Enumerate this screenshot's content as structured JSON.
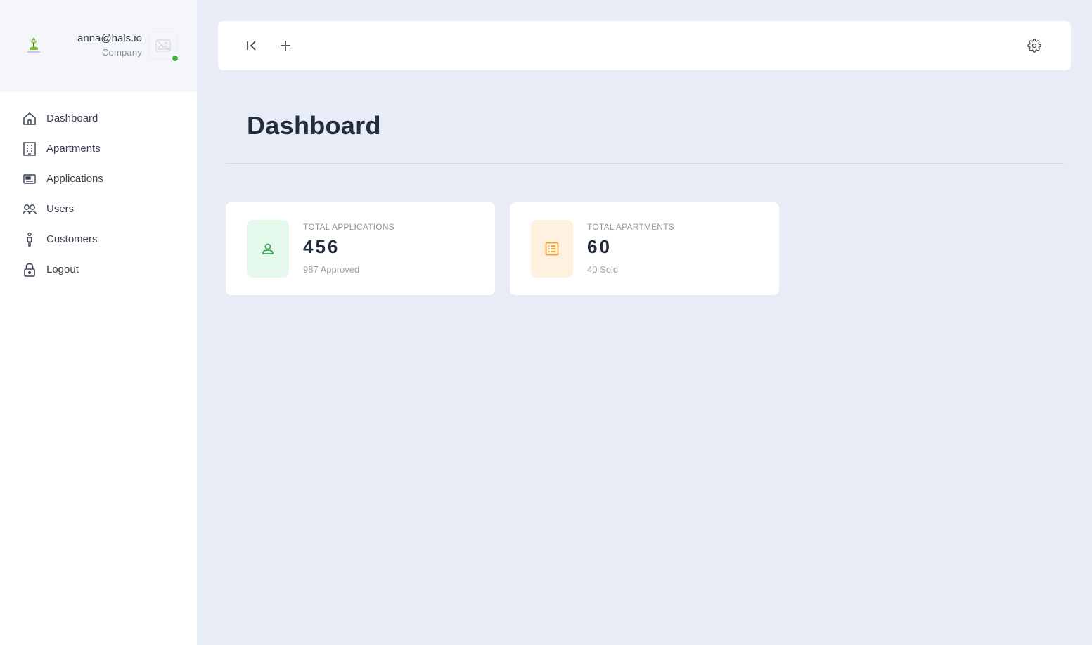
{
  "user": {
    "email": "anna@hals.io",
    "role": "Company",
    "status_color": "#3cb043"
  },
  "sidebar": {
    "items": [
      {
        "label": "Dashboard",
        "icon": "home-icon"
      },
      {
        "label": "Apartments",
        "icon": "building-icon"
      },
      {
        "label": "Applications",
        "icon": "card-icon"
      },
      {
        "label": "Users",
        "icon": "users-icon"
      },
      {
        "label": "Customers",
        "icon": "person-icon"
      },
      {
        "label": "Logout",
        "icon": "lock-icon"
      }
    ]
  },
  "topbar": {
    "icons": [
      "collapse-sidebar-icon",
      "plus-icon",
      "gear-icon"
    ]
  },
  "page": {
    "title": "Dashboard"
  },
  "cards": [
    {
      "label": "TOTAL APPLICATIONS",
      "value": "456",
      "sub": "987 Approved",
      "icon": "user-icon",
      "accent": "#3ba55c",
      "bg": "#e4f8ec"
    },
    {
      "label": "TOTAL APARTMENTS",
      "value": "60",
      "sub": "40 Sold",
      "icon": "list-icon",
      "accent": "#f0a030",
      "bg": "#fff1e0"
    }
  ]
}
